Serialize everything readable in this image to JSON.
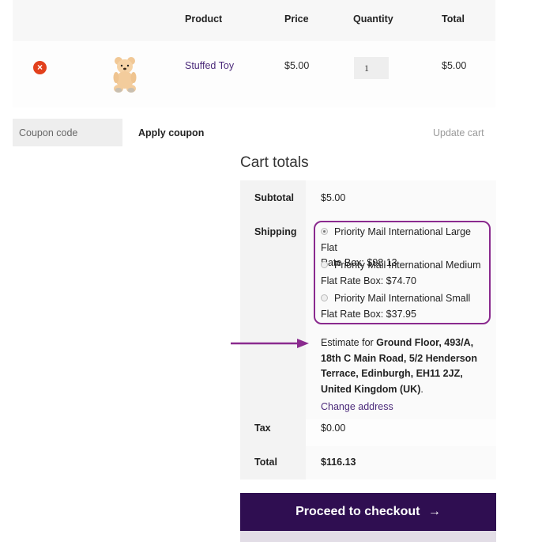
{
  "cart_table": {
    "headers": [
      "",
      "",
      "Product",
      "Price",
      "Quantity",
      "Total"
    ],
    "items": [
      {
        "remove_icon": "remove-circle-x-icon",
        "thumbnail": "teddy-bear-image",
        "product": "Stuffed Toy",
        "price": "$5.00",
        "quantity": "1",
        "total": "$5.00"
      }
    ]
  },
  "actions": {
    "coupon_placeholder": "Coupon code",
    "apply_coupon": "Apply coupon",
    "update_cart": "Update cart"
  },
  "cart_totals": {
    "title": "Cart totals",
    "subtotal_label": "Subtotal",
    "subtotal_value": "$5.00",
    "shipping_label": "Shipping",
    "shipping_options": [
      {
        "line1": "Priority Mail International Large Flat",
        "line2": "Rate Box: $98.13",
        "selected": true
      },
      {
        "line1": "Priority Mail International Medium",
        "line2": "Flat Rate Box: $74.70",
        "selected": false
      },
      {
        "line1": "Priority Mail International Small",
        "line2": "Flat Rate Box: $37.95",
        "selected": false
      }
    ],
    "estimate_prefix": "Estimate for ",
    "estimate_address": "Ground Floor, 493/A, 18th C Main Road, 5/2 Henderson Terrace, Edinburgh, EH11 2JZ, United Kingdom (UK)",
    "estimate_suffix": ".",
    "change_address": "Change address",
    "tax_label": "Tax",
    "tax_value": "$0.00",
    "total_label": "Total",
    "total_value": "$116.13"
  },
  "checkout": {
    "label": "Proceed to checkout",
    "arrow": "→"
  },
  "colors": {
    "accent": "#2f0e51",
    "link": "#4b2a7a",
    "annotation": "#8a2a8e",
    "remove": "#e2401c"
  }
}
